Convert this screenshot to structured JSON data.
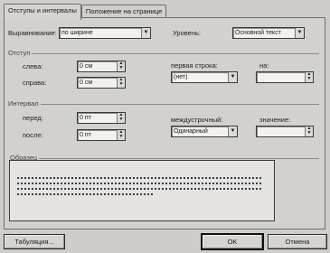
{
  "tabs": [
    {
      "label": "Отступы и интервалы",
      "active": true
    },
    {
      "label": "Положение на странице",
      "active": false
    }
  ],
  "alignment": {
    "label": "Выравнивание:",
    "value": "по ширине"
  },
  "level": {
    "label": "Уровень:",
    "value": "Основной текст"
  },
  "indent": {
    "group_label": "Отступ",
    "left_label": "слева:",
    "left_value": "0 см",
    "right_label": "справа:",
    "right_value": "0 см",
    "first_line_label": "первая строка:",
    "first_line_value": "(нет)",
    "by_label": "на:",
    "by_value": ""
  },
  "spacing": {
    "group_label": "Интервал",
    "before_label": "перед:",
    "before_value": "0 пт",
    "after_label": "после:",
    "after_value": "0 пт",
    "line_spacing_label": "междустрочный:",
    "line_spacing_value": "Одинарный",
    "value_label": "значение:",
    "value_value": ""
  },
  "preview": {
    "group_label": "Образец"
  },
  "buttons": {
    "tabs": "Табуляция...",
    "ok": "OK",
    "cancel": "Отмена"
  },
  "icons": {
    "spin_up": "▲",
    "spin_down": "▼",
    "dropdown": "▼"
  }
}
